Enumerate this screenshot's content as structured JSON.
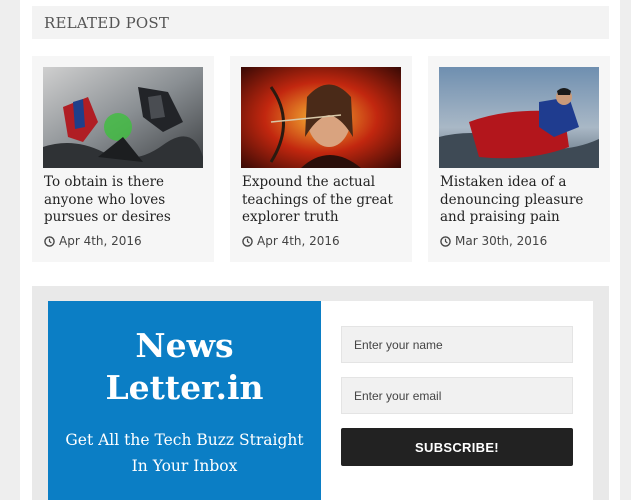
{
  "related": {
    "heading": "RELATED POST",
    "posts": [
      {
        "title_lines": [
          "To obtain is there",
          "anyone who loves",
          "pursues or desires"
        ],
        "date": "Apr 4th, 2016",
        "image": "superhero-battle-image"
      },
      {
        "title_lines": [
          "Expound the actual",
          "teachings of the great",
          "explorer truth"
        ],
        "date": "Apr 4th, 2016",
        "image": "archer-flames-image"
      },
      {
        "title_lines": [
          "Mistaken idea of a",
          "denouncing pleasure",
          "and praising pain"
        ],
        "date": "Mar 30th, 2016",
        "image": "flying-superhero-image"
      }
    ]
  },
  "newsletter": {
    "brand_line1": "News",
    "brand_line2": "Letter.in",
    "tagline_line1": "Get All the Tech Buzz Straight",
    "tagline_line2": "In Your Inbox",
    "name_placeholder": "Enter your name",
    "email_placeholder": "Enter your email",
    "subscribe_label": "SUBSCRIBE!",
    "colors": {
      "panel": "#0b7ec5",
      "button": "#222222"
    }
  }
}
